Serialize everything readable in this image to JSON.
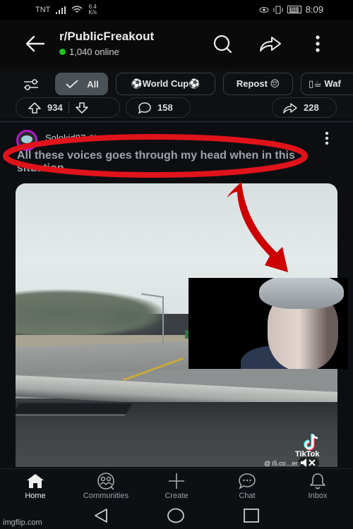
{
  "status_bar": {
    "carrier": "TNT",
    "net_speed": "6.4",
    "net_speed_unit": "K/s",
    "battery": "51",
    "time": "8:09"
  },
  "header": {
    "subreddit": "r/PublicFreakout",
    "online": "1,040 online",
    "icons": [
      "back-arrow-icon",
      "search-icon",
      "share-icon",
      "more-vertical-icon"
    ]
  },
  "filters": {
    "chips": [
      {
        "label": "All",
        "active": true,
        "icon": "checkmark-icon"
      },
      {
        "label": "⚽World Cup⚽",
        "active": false
      },
      {
        "label": "Repost 😔",
        "active": false
      },
      {
        "label": "▯☕ Waf",
        "active": false
      }
    ]
  },
  "post_actions": {
    "upvotes": "934",
    "comments": "158",
    "shares": "228"
  },
  "post": {
    "author": "Solokid87",
    "age": "2h",
    "title": "All these voices goes through my head when in this situation",
    "media": {
      "tiktok_label": "TikTok",
      "tiktok_handle": "@ i5.co…ers"
    }
  },
  "annotations": {
    "ellipse_color": "#e0131b",
    "arrow_color": "#cc0000"
  },
  "bottom_nav": [
    {
      "label": "Home",
      "icon": "home-icon",
      "active": true
    },
    {
      "label": "Communities",
      "icon": "communities-icon",
      "active": false
    },
    {
      "label": "Create",
      "icon": "plus-icon",
      "active": false
    },
    {
      "label": "Chat",
      "icon": "chat-icon",
      "active": false
    },
    {
      "label": "Inbox",
      "icon": "bell-icon",
      "active": false
    }
  ],
  "watermark": "imgflip.com"
}
